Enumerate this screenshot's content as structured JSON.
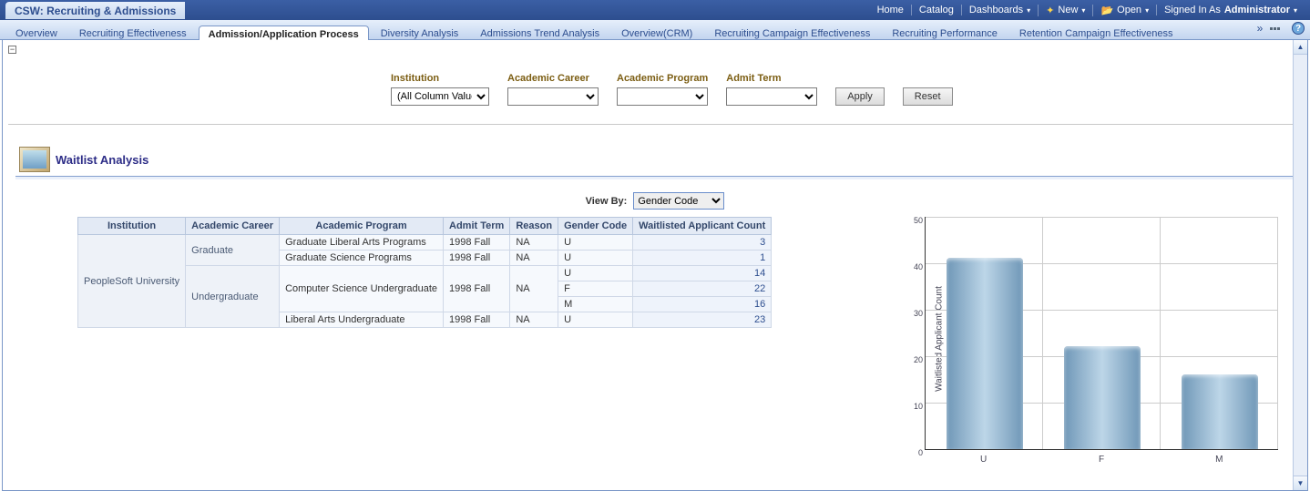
{
  "topbar": {
    "dashboard_title": "CSW: Recruiting & Admissions",
    "links": {
      "home": "Home",
      "catalog": "Catalog",
      "dashboards": "Dashboards",
      "new": "New",
      "open": "Open",
      "signed_in_label": "Signed In As",
      "user": "Administrator"
    }
  },
  "tabs": [
    "Overview",
    "Recruiting Effectiveness",
    "Admission/Application Process",
    "Diversity Analysis",
    "Admissions Trend Analysis",
    "Overview(CRM)",
    "Recruiting Campaign Effectiveness",
    "Recruiting Performance",
    "Retention Campaign Effectiveness"
  ],
  "active_tab_index": 2,
  "filters": {
    "institution": {
      "label": "Institution",
      "value": "(All Column Values)"
    },
    "career": {
      "label": "Academic Career",
      "value": ""
    },
    "program": {
      "label": "Academic Program",
      "value": ""
    },
    "term": {
      "label": "Admit Term",
      "value": ""
    },
    "apply_btn": "Apply",
    "reset_btn": "Reset"
  },
  "section": {
    "title": "Waitlist Analysis",
    "viewby_label": "View By:",
    "viewby_value": "Gender Code"
  },
  "table": {
    "headers": [
      "Institution",
      "Academic Career",
      "Academic Program",
      "Admit Term",
      "Reason",
      "Gender Code",
      "Waitlisted Applicant Count"
    ],
    "institution": "PeopleSoft University",
    "graduate_label": "Graduate",
    "undergrad_label": "Undergraduate",
    "rows": [
      {
        "program": "Graduate Liberal Arts Programs",
        "term": "1998 Fall",
        "reason": "NA",
        "gender": "U",
        "count": "3"
      },
      {
        "program": "Graduate Science Programs",
        "term": "1998 Fall",
        "reason": "NA",
        "gender": "U",
        "count": "1"
      },
      {
        "program": "Computer Science Undergraduate",
        "term": "1998 Fall",
        "reason": "NA",
        "gender": "U",
        "count": "14"
      },
      {
        "program": "Computer Science Undergraduate",
        "term": "1998 Fall",
        "reason": "NA",
        "gender": "F",
        "count": "22"
      },
      {
        "program": "Computer Science Undergraduate",
        "term": "1998 Fall",
        "reason": "NA",
        "gender": "M",
        "count": "16"
      },
      {
        "program": "Liberal Arts Undergraduate",
        "term": "1998 Fall",
        "reason": "NA",
        "gender": "U",
        "count": "23"
      }
    ]
  },
  "chart_data": {
    "type": "bar",
    "categories": [
      "U",
      "F",
      "M"
    ],
    "values": [
      41,
      22,
      16
    ],
    "title": "",
    "xlabel": "",
    "ylabel": "Waitlisted Applicant Count",
    "ylim": [
      0,
      50
    ],
    "yticks": [
      "0",
      "10",
      "20",
      "30",
      "40",
      "50"
    ]
  }
}
